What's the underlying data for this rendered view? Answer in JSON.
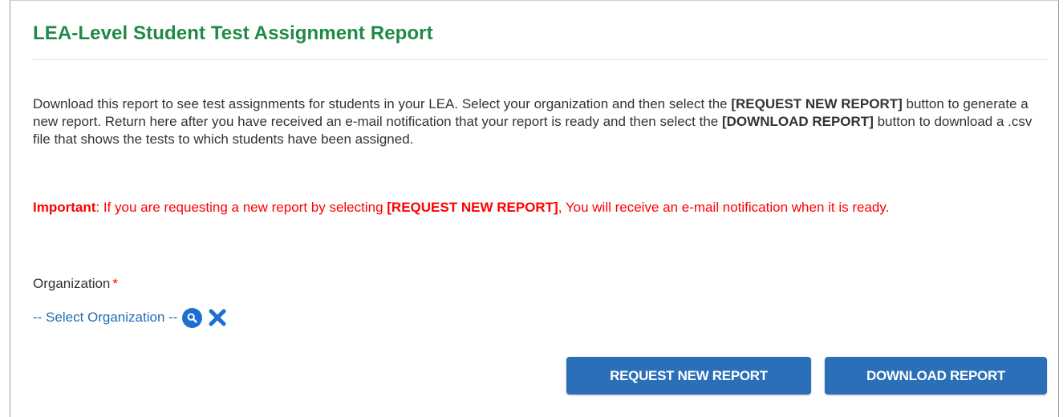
{
  "header": {
    "title": "LEA-Level Student Test Assignment Report"
  },
  "description": {
    "part1": "Download this report to see test assignments for students in your LEA. Select your organization and then select the ",
    "bold1": "[REQUEST NEW REPORT]",
    "part2": " button to generate a new report. Return here after you have received an e-mail notification that your report is ready and then select the ",
    "bold2": "[DOWNLOAD REPORT]",
    "part3": " button to download a .csv file that shows the tests to which students have been assigned."
  },
  "important": {
    "label": "Important",
    "part1": ": If you are requesting a new report by selecting ",
    "bold": "[REQUEST NEW REPORT]",
    "part2": ", You will receive an e-mail notification when it is ready."
  },
  "organization": {
    "label": "Organization",
    "required_marker": "*",
    "select_text": "-- Select Organization --",
    "search_icon": "search-icon",
    "clear_icon": "close-icon"
  },
  "actions": {
    "request_label": "REQUEST NEW REPORT",
    "download_label": "DOWNLOAD REPORT"
  },
  "colors": {
    "title": "#1f8a45",
    "important": "#ff0000",
    "link": "#1f6db8",
    "button": "#2a6fb7",
    "icon": "#1d6fd0"
  }
}
